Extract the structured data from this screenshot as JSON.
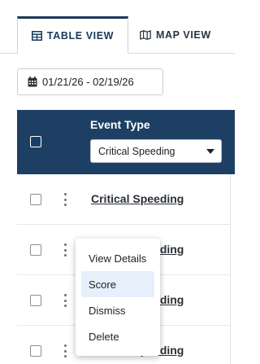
{
  "tabs": [
    {
      "label": "TABLE VIEW",
      "icon": "table-icon",
      "active": true
    },
    {
      "label": "MAP VIEW",
      "icon": "map-icon",
      "active": false
    }
  ],
  "date_range": {
    "icon": "calendar-icon",
    "value": "01/21/26 - 02/19/26"
  },
  "table": {
    "header": {
      "column_title": "Event Type",
      "filter_value": "Critical Speeding"
    },
    "rows": [
      {
        "event": "Critical Speeding"
      },
      {
        "event": "Critical Speeding"
      },
      {
        "event": "Critical Speeding"
      },
      {
        "event": "Critical Speeding"
      }
    ]
  },
  "context_menu": {
    "items": [
      "View Details",
      "Score",
      "Dismiss",
      "Delete"
    ],
    "highlighted": "Score"
  },
  "colors": {
    "header_bg": "#1d3f63",
    "accent": "#1a3a5c",
    "menu_highlight": "#e6f0fb"
  }
}
